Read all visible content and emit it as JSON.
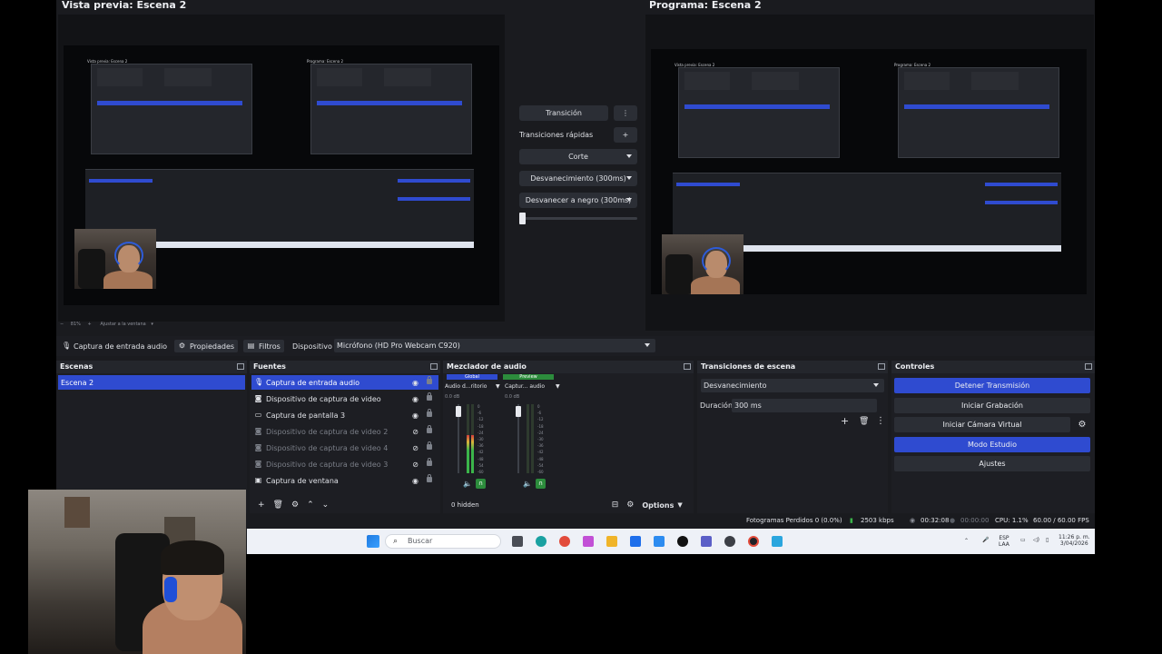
{
  "preview": {
    "title": "Vista previa: Escena 2",
    "zoom_label": "81%",
    "fit_label": "Ajustar a la ventana"
  },
  "program": {
    "title": "Programa: Escena 2"
  },
  "nested": {
    "preview_title": "Vista previa: Escena 2",
    "program_title": "Programa: Escena 2"
  },
  "transition_panel": {
    "transition_label": "Transición",
    "quick_label": "Transiciones rápidas",
    "items": [
      "Corte",
      "Desvanecimiento (300ms)",
      "Desvanecer a negro (300ms)"
    ]
  },
  "source_toolbar": {
    "source_name": "Captura de entrada audio",
    "properties": "Propiedades",
    "filters": "Filtros",
    "device_label": "Dispositivo",
    "device_value": "Micrófono (HD Pro Webcam C920)"
  },
  "scenes": {
    "title": "Escenas",
    "items": [
      {
        "label": "Escena 2",
        "selected": true
      }
    ]
  },
  "sources": {
    "title": "Fuentes",
    "items": [
      {
        "label": "Captura de entrada audio",
        "icon": "microphone-icon",
        "selected": true,
        "visible": true
      },
      {
        "label": "Dispositivo de captura de video",
        "icon": "camera-icon",
        "selected": false,
        "visible": true
      },
      {
        "label": "Captura de pantalla 3",
        "icon": "monitor-icon",
        "selected": false,
        "visible": true
      },
      {
        "label": "Dispositivo de captura de video 2",
        "icon": "camera-icon",
        "selected": false,
        "visible": false
      },
      {
        "label": "Dispositivo de captura de video 4",
        "icon": "camera-icon",
        "selected": false,
        "visible": false
      },
      {
        "label": "Dispositivo de captura de video 3",
        "icon": "camera-icon",
        "selected": false,
        "visible": false
      },
      {
        "label": "Captura de ventana",
        "icon": "window-icon",
        "selected": false,
        "visible": true
      }
    ]
  },
  "mixer": {
    "title": "Mezclador de audio",
    "tag_global": "Global",
    "tag_preview": "Preview",
    "channels": [
      {
        "name": "Audio d...ritorio",
        "db": "0.0 dB",
        "level": 0.55
      },
      {
        "name": "Captur... audio",
        "db": "0.0 dB",
        "level": 0.0
      }
    ],
    "ticks": [
      "0",
      "-6",
      "-12",
      "-18",
      "-24",
      "-30",
      "-36",
      "-42",
      "-48",
      "-54",
      "-60"
    ],
    "hidden": "0 hidden",
    "options": "Options"
  },
  "scene_transitions": {
    "title": "Transiciones de escena",
    "transition": "Desvanecimiento",
    "duration_label": "Duración",
    "duration_value": "300 ms"
  },
  "controls": {
    "title": "Controles",
    "buttons": [
      "Detener Transmisión",
      "Iniciar Grabación",
      "Iniciar Cámara Virtual",
      "Modo Estudio",
      "Ajustes"
    ]
  },
  "status": {
    "dropped": "Fotogramas Perdidos 0 (0.0%)",
    "kbps": "2503 kbps",
    "stream_time": "00:32:08",
    "rec_time": "00:00:00",
    "cpu": "CPU: 1.1%",
    "fps": "60.00 / 60.00 FPS"
  },
  "taskbar": {
    "search": "Buscar",
    "lang": "ESP",
    "lang2": "LAA",
    "time": "11:26 p. m.",
    "date": "3/04/2026"
  },
  "colors": {
    "accent": "#2f4bd0",
    "panel": "#1d1e23",
    "background": "#1a1b1f",
    "meter_green": "#3bb54a",
    "meter_red": "#d23c3c"
  }
}
